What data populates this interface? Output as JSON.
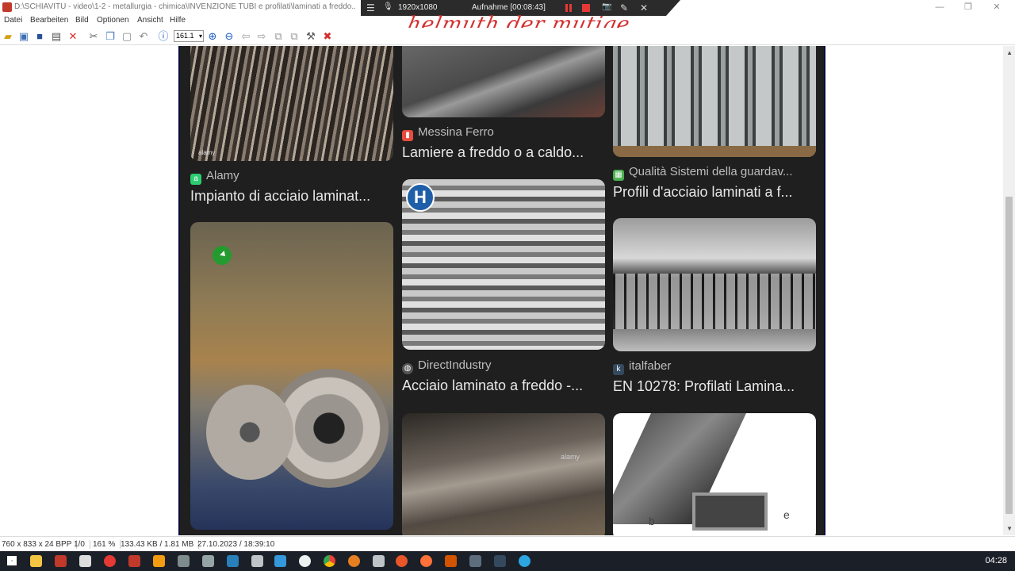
{
  "window": {
    "title": "D:\\SCHIAVITÙ - video\\1-2 - metallurgia - chimica\\INVENZIONE TUBI e profilati\\laminati a freddo...",
    "minimize": "—",
    "maximize": "❐",
    "close": "✕"
  },
  "recorder": {
    "menu_icon": "☰",
    "mic_icon": "🎙",
    "resolution": "1920x1080",
    "status": "Aufnahme [00:08:43]",
    "camera_icon": "📷",
    "pen_icon": "✎",
    "close_icon": "✕"
  },
  "signature": "helmuth der mutige",
  "menu": [
    "Datei",
    "Bearbeiten",
    "Bild",
    "Optionen",
    "Ansicht",
    "Hilfe"
  ],
  "toolbar": {
    "zoom_value": "161.1",
    "icons": [
      "open-folder-icon",
      "slideshow-icon",
      "save-icon",
      "print-icon",
      "delete-icon",
      "cut-icon",
      "copy-icon",
      "paste-icon",
      "undo-icon",
      "info-icon",
      "zoom-in-icon",
      "zoom-out-icon",
      "prev-icon",
      "next-icon",
      "first-page-icon",
      "last-page-icon",
      "settings-icon",
      "exit-icon"
    ]
  },
  "tiles": [
    {
      "source": "Alamy",
      "title": "Impianto di acciaio laminat..."
    },
    {
      "source": "Messina Ferro",
      "title": "Lamiere a freddo o a caldo..."
    },
    {
      "source": "Qualità Sistemi della guardav...",
      "title": "Profili d'acciaio laminati a f..."
    },
    {
      "source": "DirectIndustry",
      "title": "Acciaio laminato a freddo -..."
    },
    {
      "source": "italfaber",
      "title": "EN 10278: Profilati Lamina..."
    }
  ],
  "image_labels": {
    "alamy_watermark": "alamy",
    "dim_b": "b",
    "dim_e": "e"
  },
  "statusbar": {
    "dimensions": "760 x 833 x 24 BPP",
    "page": "1/0",
    "zoom": "161 %",
    "size": "133.43 KB / 1.81 MB",
    "datetime": "27.10.2023 / 18:39:10"
  },
  "taskbar": {
    "clock": "04:28"
  },
  "colors": {
    "image_background": "#1f1f1f",
    "record_red": "#e53935",
    "signature_red": "#d32f2f",
    "taskbar": "#1b1f27"
  }
}
